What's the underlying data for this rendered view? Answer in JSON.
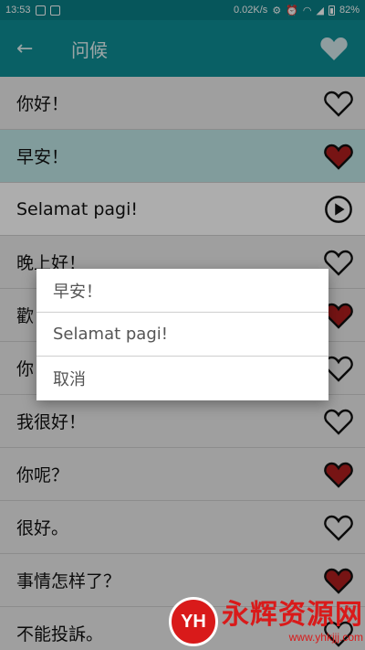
{
  "status_bar": {
    "time": "13:53",
    "speed": "0.02K/s",
    "battery": "82%"
  },
  "app_bar": {
    "back_icon": "arrow-left-icon",
    "title": "问候",
    "favorite_icon": "heart-filled-icon"
  },
  "list": {
    "rows": [
      {
        "text": "你好！",
        "icon": "heart-outline-icon"
      },
      {
        "text": "早安！",
        "icon": "heart-filled-icon"
      },
      {
        "text": "Selamat pagi!",
        "icon": "play-icon"
      },
      {
        "text": "晚上好！",
        "icon": "heart-outline-icon"
      },
      {
        "text": "歡",
        "icon": "heart-filled-icon"
      },
      {
        "text": "你",
        "icon": "heart-outline-icon"
      },
      {
        "text": "我很好！",
        "icon": "heart-outline-icon"
      },
      {
        "text": "你呢？",
        "icon": "heart-filled-icon"
      },
      {
        "text": "很好。",
        "icon": "heart-outline-icon"
      },
      {
        "text": "事情怎样了？",
        "icon": "heart-filled-icon"
      },
      {
        "text": "不能投訴。",
        "icon": "heart-outline-icon"
      }
    ]
  },
  "dialog": {
    "items": [
      "早安！",
      "Selamat pagi!",
      "取消"
    ]
  },
  "watermark": {
    "logo": "YH",
    "title": "永辉资源网",
    "url": "www.yhkjjj.com"
  },
  "colors": {
    "app_bar": "#0e8e96",
    "status_bar": "#0a7f86",
    "highlight_row": "#bfe6e6",
    "heart_filled": "#b01e1e"
  }
}
